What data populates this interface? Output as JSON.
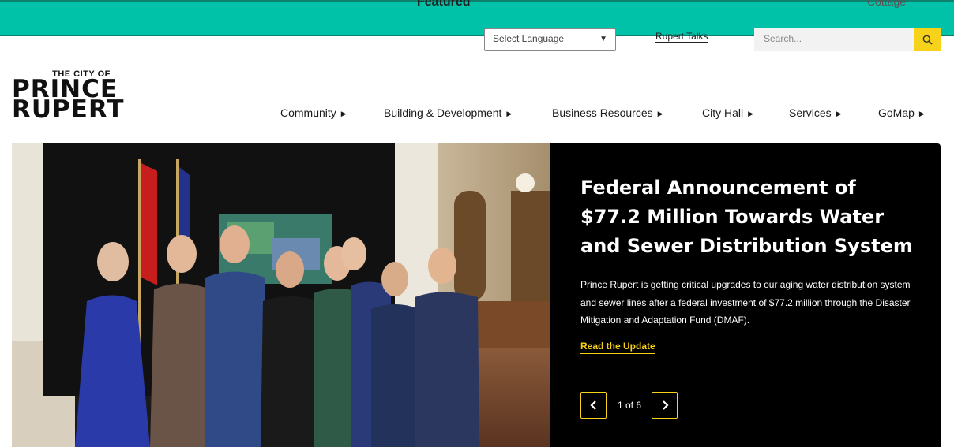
{
  "peek": {
    "label": "Featured",
    "right": "Cottage"
  },
  "utility": {
    "language_placeholder": "Select Language",
    "talks_link": "Rupert Talks",
    "search_placeholder": "Search..."
  },
  "logo": {
    "small": "THE CITY OF",
    "line1": "PRINCE",
    "line2": "RUPERT"
  },
  "nav": [
    {
      "label": "Community"
    },
    {
      "label": "Building & Development"
    },
    {
      "label": "Business Resources"
    },
    {
      "label": "City Hall"
    },
    {
      "label": "Services"
    },
    {
      "label": "GoMap"
    }
  ],
  "hero": {
    "title": "Federal Announcement of $77.2 Million Towards Water and Sewer Distribution System",
    "description": "Prince Rupert is getting critical upgrades to our aging water distribution system and sewer lines after a federal investment of $77.2 million through the Disaster Mitigation and Adaptation Fund (DMAF).",
    "cta": "Read the Update",
    "pager": "1 of 6"
  },
  "colors": {
    "teal": "#00c2a8",
    "yellow": "#f7d21a",
    "panel": "#000000"
  }
}
